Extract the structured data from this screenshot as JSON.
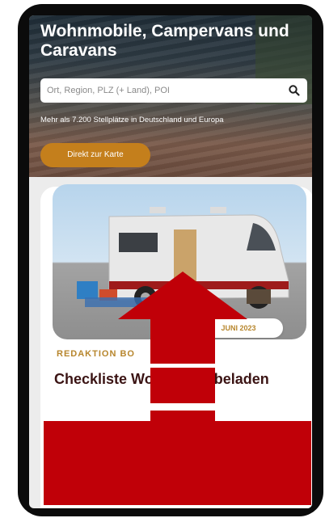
{
  "hero": {
    "title": "Wohnmobile, Campervans und Caravans",
    "search_placeholder": "Ort, Region, PLZ (+ Land), POI",
    "search_icon": "search-icon",
    "subtitle": "Mehr als 7.200 Stellplätze in Deutschland und Europa",
    "map_button_label": "Direkt zur Karte"
  },
  "article": {
    "date": "JUNI 2023",
    "author": "REDAKTION BO",
    "title": "Checkliste Wohnmobil beladen"
  },
  "colors": {
    "accent": "#c47f1c",
    "arrow": "#c00008",
    "title": "#3b1414"
  }
}
